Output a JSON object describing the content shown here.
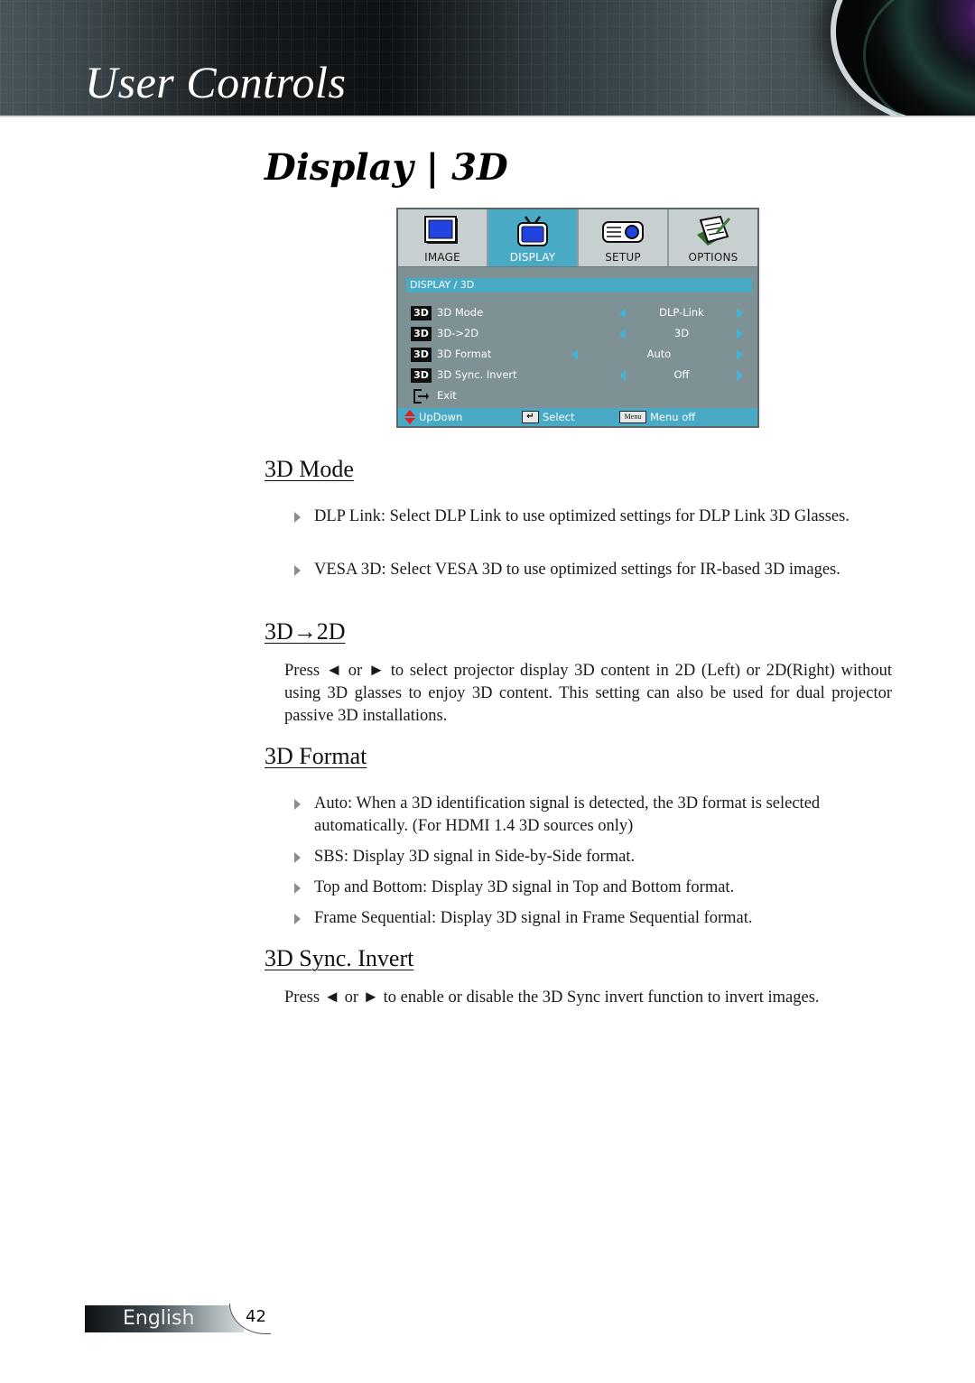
{
  "header": {
    "section_title": "User Controls"
  },
  "page": {
    "title": "Display | 3D"
  },
  "osd": {
    "tabs": [
      {
        "label": "IMAGE",
        "icon": "monitor-icon",
        "active": false
      },
      {
        "label": "DISPLAY",
        "icon": "tv-icon",
        "active": true
      },
      {
        "label": "SETUP",
        "icon": "projector-icon",
        "active": false
      },
      {
        "label": "OPTIONS",
        "icon": "notepad-icon",
        "active": false
      }
    ],
    "breadcrumb": "DISPLAY / 3D",
    "badge": "3D",
    "rows": [
      {
        "label": "3D Mode",
        "value": "DLP-Link"
      },
      {
        "label": "3D->2D",
        "value": "3D"
      },
      {
        "label": "3D Format",
        "value": "Auto"
      },
      {
        "label": "3D Sync. Invert",
        "value": "Off"
      }
    ],
    "exit_label": "Exit",
    "status": {
      "updown": "UpDown",
      "select": "Select",
      "menu_key": "Menu",
      "menu_off": "Menu off"
    },
    "colors": {
      "accent": "#49aac6",
      "panel": "#7e9194",
      "tab_bg": "#c7cfd0"
    }
  },
  "sections": {
    "mode": {
      "heading": "3D Mode",
      "bullets": [
        "DLP Link: Select DLP Link to use optimized settings for DLP Link 3D Glasses.",
        "VESA 3D: Select VESA 3D to use optimized settings for IR-based 3D images."
      ]
    },
    "to2d": {
      "heading": "3D→2D",
      "paragraph": "Press ◄ or ► to select projector display 3D content in 2D (Left) or 2D(Right) without using 3D glasses to enjoy 3D content. This setting can also be used for dual projector passive 3D installations."
    },
    "format": {
      "heading": "3D Format",
      "bullets": [
        "Auto: When a 3D identification signal is detected, the 3D format is selected automatically. (For HDMI 1.4 3D sources only)",
        "SBS: Display 3D signal in Side-by-Side format.",
        "Top and Bottom: Display 3D signal in Top and Bottom format.",
        "Frame Sequential: Display 3D signal in Frame Sequential format."
      ]
    },
    "sync": {
      "heading": "3D Sync. Invert",
      "paragraph": "Press ◄ or ► to enable or disable the 3D Sync invert function to invert images."
    }
  },
  "footer": {
    "language": "English",
    "page_number": "42"
  }
}
